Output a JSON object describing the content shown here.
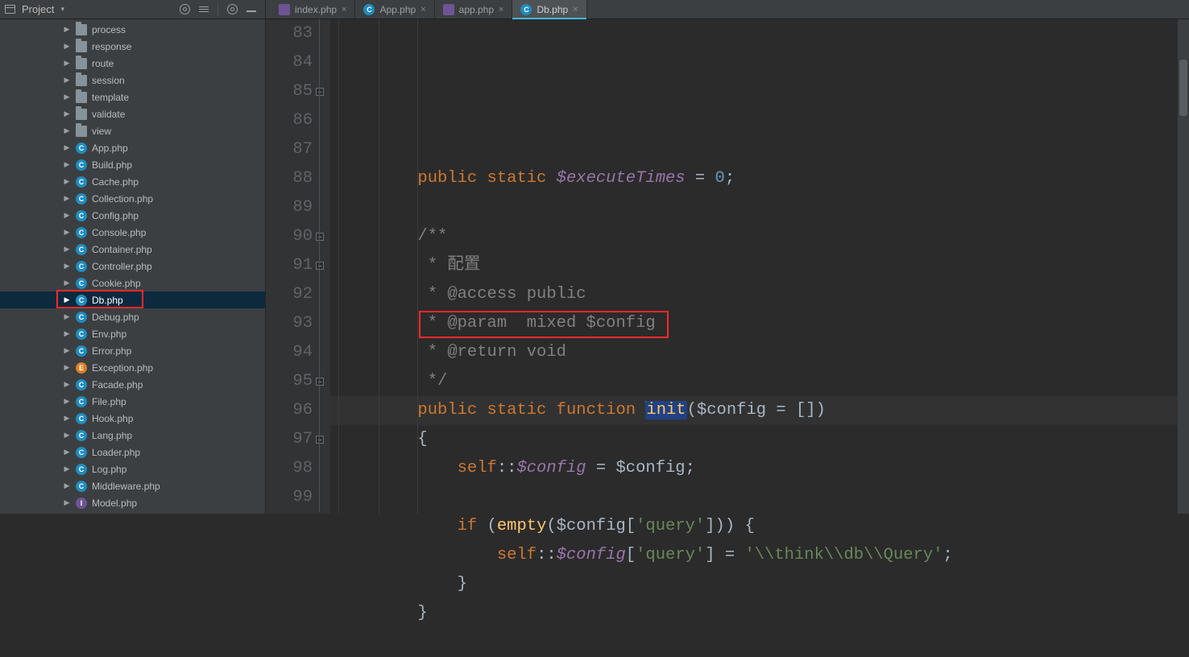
{
  "project_panel": {
    "title": "Project"
  },
  "tabs": [
    {
      "label": "index.php",
      "icon": "php-stack",
      "active": false
    },
    {
      "label": "App.php",
      "icon": "php-class",
      "active": false
    },
    {
      "label": "app.php",
      "icon": "php-stack",
      "active": false
    },
    {
      "label": "Db.php",
      "icon": "php-class",
      "active": true
    }
  ],
  "tree": [
    {
      "label": "process",
      "icon": "folder"
    },
    {
      "label": "response",
      "icon": "folder"
    },
    {
      "label": "route",
      "icon": "folder"
    },
    {
      "label": "session",
      "icon": "folder"
    },
    {
      "label": "template",
      "icon": "folder"
    },
    {
      "label": "validate",
      "icon": "folder"
    },
    {
      "label": "view",
      "icon": "folder"
    },
    {
      "label": "App.php",
      "icon": "class"
    },
    {
      "label": "Build.php",
      "icon": "class"
    },
    {
      "label": "Cache.php",
      "icon": "class"
    },
    {
      "label": "Collection.php",
      "icon": "class"
    },
    {
      "label": "Config.php",
      "icon": "class"
    },
    {
      "label": "Console.php",
      "icon": "class"
    },
    {
      "label": "Container.php",
      "icon": "class"
    },
    {
      "label": "Controller.php",
      "icon": "class"
    },
    {
      "label": "Cookie.php",
      "icon": "class"
    },
    {
      "label": "Db.php",
      "icon": "class",
      "selected": true,
      "boxed": true
    },
    {
      "label": "Debug.php",
      "icon": "class"
    },
    {
      "label": "Env.php",
      "icon": "class"
    },
    {
      "label": "Error.php",
      "icon": "class"
    },
    {
      "label": "Exception.php",
      "icon": "exception"
    },
    {
      "label": "Facade.php",
      "icon": "class"
    },
    {
      "label": "File.php",
      "icon": "class"
    },
    {
      "label": "Hook.php",
      "icon": "class"
    },
    {
      "label": "Lang.php",
      "icon": "class"
    },
    {
      "label": "Loader.php",
      "icon": "class"
    },
    {
      "label": "Log.php",
      "icon": "class"
    },
    {
      "label": "Middleware.php",
      "icon": "class"
    },
    {
      "label": "Model.php",
      "icon": "interface"
    }
  ],
  "code": {
    "lines": [
      {
        "n": 83,
        "tokens": [
          [
            "pad",
            "        "
          ],
          [
            "kw",
            "public"
          ],
          [
            "sp",
            " "
          ],
          [
            "kw",
            "static"
          ],
          [
            "sp",
            " "
          ],
          [
            "var",
            "$executeTimes"
          ],
          [
            "sp",
            " "
          ],
          [
            "op",
            "= "
          ],
          [
            "num",
            "0"
          ],
          [
            "op",
            ";"
          ]
        ]
      },
      {
        "n": 84,
        "tokens": []
      },
      {
        "n": 85,
        "tokens": [
          [
            "pad",
            "        "
          ],
          [
            "cmt",
            "/**"
          ]
        ]
      },
      {
        "n": 86,
        "tokens": [
          [
            "pad",
            "        "
          ],
          [
            "cmt",
            " * 配置"
          ]
        ]
      },
      {
        "n": 87,
        "tokens": [
          [
            "pad",
            "        "
          ],
          [
            "cmt",
            " * @access public"
          ]
        ]
      },
      {
        "n": 88,
        "tokens": [
          [
            "pad",
            "        "
          ],
          [
            "cmt",
            " * @param  mixed $config"
          ]
        ]
      },
      {
        "n": 89,
        "tokens": [
          [
            "pad",
            "        "
          ],
          [
            "cmt",
            " * @return void"
          ]
        ]
      },
      {
        "n": 90,
        "tokens": [
          [
            "pad",
            "        "
          ],
          [
            "cmt",
            " */"
          ]
        ]
      },
      {
        "n": 91,
        "cur": true,
        "tokens": [
          [
            "pad",
            "        "
          ],
          [
            "kw",
            "public"
          ],
          [
            "sp",
            " "
          ],
          [
            "kw",
            "static"
          ],
          [
            "sp",
            " "
          ],
          [
            "kw",
            "function"
          ],
          [
            "sp",
            " "
          ],
          [
            "caret",
            ""
          ],
          [
            "selfn",
            "init"
          ],
          [
            "op",
            "("
          ],
          [
            "varn",
            "$config"
          ],
          [
            "sp",
            " "
          ],
          [
            "op",
            "= []"
          ],
          [
            "op",
            ")"
          ]
        ]
      },
      {
        "n": 92,
        "tokens": [
          [
            "pad",
            "        "
          ],
          [
            "op",
            "{"
          ]
        ]
      },
      {
        "n": 93,
        "tokens": [
          [
            "pad",
            "            "
          ],
          [
            "kw",
            "self"
          ],
          [
            "op",
            "::"
          ],
          [
            "var",
            "$config"
          ],
          [
            "sp",
            " "
          ],
          [
            "op",
            "= "
          ],
          [
            "varn",
            "$config"
          ],
          [
            "op",
            ";"
          ]
        ]
      },
      {
        "n": 94,
        "tokens": []
      },
      {
        "n": 95,
        "tokens": [
          [
            "pad",
            "            "
          ],
          [
            "kw",
            "if"
          ],
          [
            "sp",
            " "
          ],
          [
            "op",
            "("
          ],
          [
            "fn",
            "empty"
          ],
          [
            "op",
            "("
          ],
          [
            "varn",
            "$config"
          ],
          [
            "op",
            "["
          ],
          [
            "str",
            "'query'"
          ],
          [
            "op",
            "])) {"
          ]
        ]
      },
      {
        "n": 96,
        "tokens": [
          [
            "pad",
            "                "
          ],
          [
            "kw",
            "self"
          ],
          [
            "op",
            "::"
          ],
          [
            "var",
            "$config"
          ],
          [
            "op",
            "["
          ],
          [
            "str",
            "'query'"
          ],
          [
            "op",
            "] = "
          ],
          [
            "str",
            "'\\\\think\\\\db\\\\Query'"
          ],
          [
            "op",
            ";"
          ]
        ]
      },
      {
        "n": 97,
        "tokens": [
          [
            "pad",
            "            "
          ],
          [
            "op",
            "}"
          ]
        ]
      },
      {
        "n": 98,
        "tokens": [
          [
            "pad",
            "        "
          ],
          [
            "op",
            "}"
          ]
        ]
      },
      {
        "n": 99,
        "tokens": []
      }
    ]
  }
}
